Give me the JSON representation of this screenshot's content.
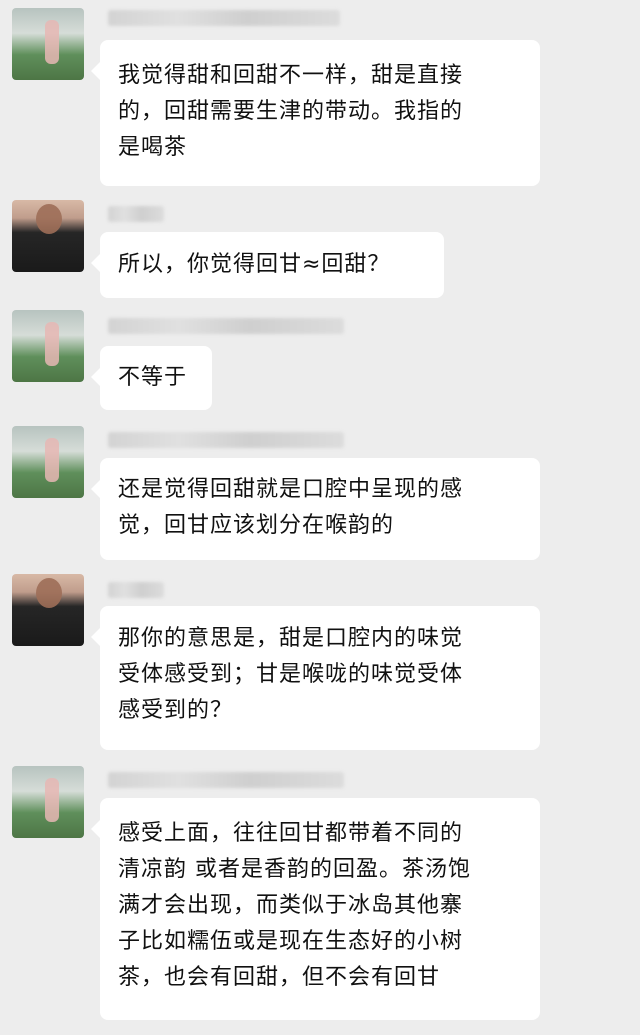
{
  "messages": [
    {
      "sender": "",
      "lines": [
        "我觉得甜和回甜不一样，甜是直接",
        "的，回甜需要生津的带动。我指的",
        "是喝茶"
      ]
    },
    {
      "sender": "",
      "lines": [
        "所以，你觉得回甘≈回甜？"
      ]
    },
    {
      "sender": "",
      "lines": [
        "不等于"
      ]
    },
    {
      "sender": "",
      "lines": [
        "还是觉得回甜就是口腔中呈现的感",
        "觉，回甘应该划分在喉韵的"
      ]
    },
    {
      "sender": "",
      "lines": [
        "那你的意思是，甜是口腔内的味觉",
        "受体感受到；甘是喉咙的味觉受体",
        "感受到的？"
      ]
    },
    {
      "sender": "",
      "lines": [
        "感受上面，往往回甘都带着不同的",
        "清凉韵 或者是香韵的回盈。茶汤饱",
        "满才会出现，而类似于冰岛其他寨",
        "子比如糯伍或是现在生态好的小树",
        "茶，也会有回甜，但不会有回甘"
      ]
    }
  ]
}
